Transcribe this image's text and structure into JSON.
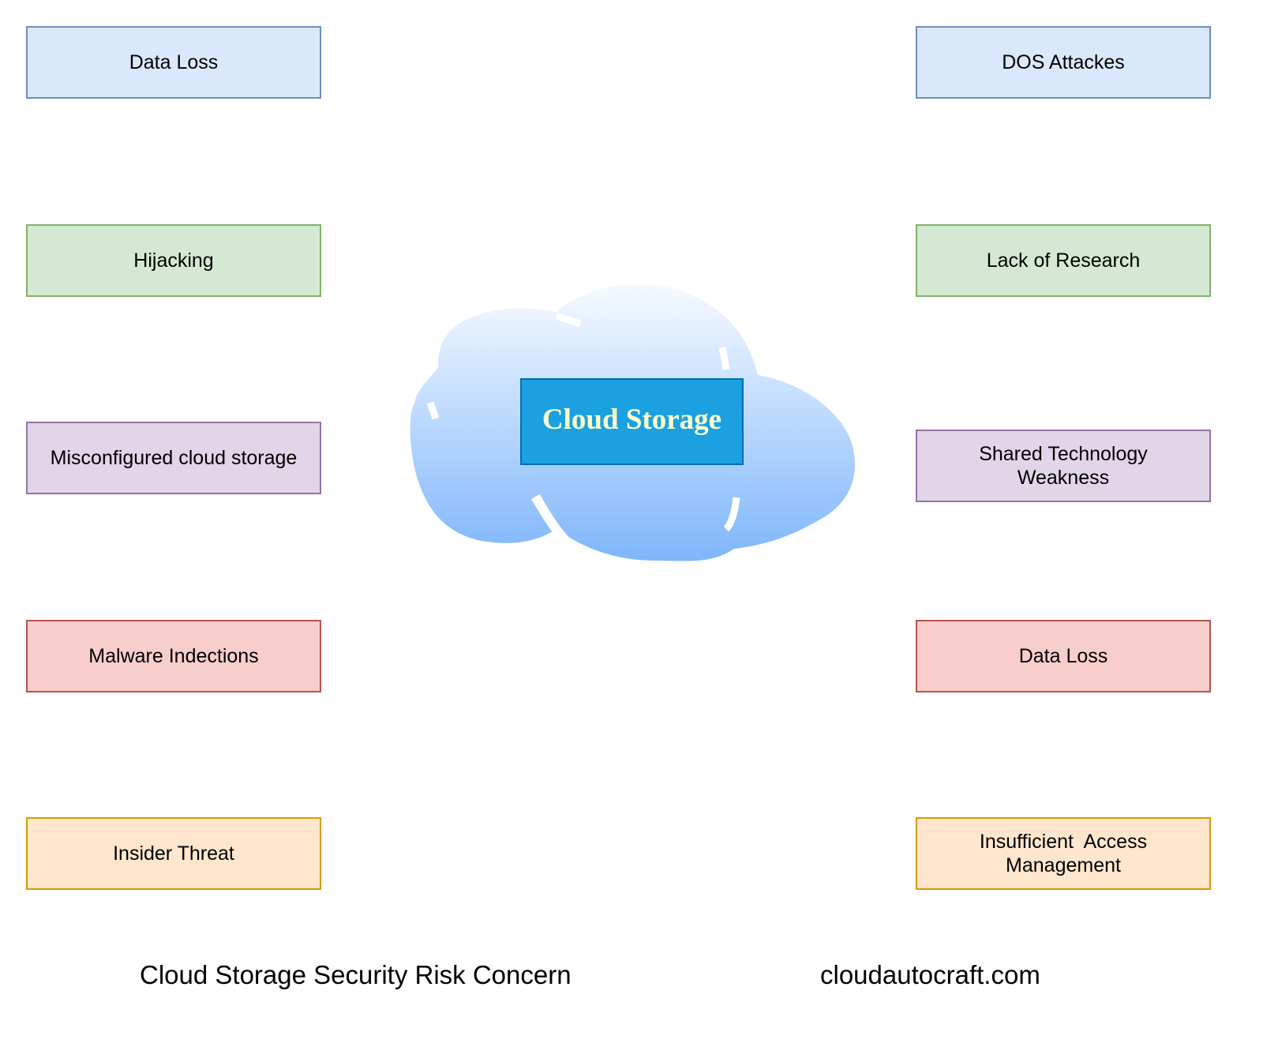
{
  "center": {
    "label": "Cloud Storage",
    "fill": "#1ba1e2",
    "text_color": "#ffffcc"
  },
  "left_boxes": [
    {
      "label": "Data Loss"
    },
    {
      "label": "Hijacking"
    },
    {
      "label": "Misconfigured cloud storage"
    },
    {
      "label": "Malware Indections"
    },
    {
      "label": "Insider Threat"
    }
  ],
  "right_boxes": [
    {
      "label": "DOS Attackes"
    },
    {
      "label": "Lack of Research"
    },
    {
      "label": "Shared Technology Weakness"
    },
    {
      "label": "Data Loss"
    },
    {
      "label": "Insufficient  Access Management"
    }
  ],
  "footer": {
    "caption": "Cloud Storage Security Risk Concern",
    "site": "cloudautocraft.com"
  },
  "colors": {
    "blue": "#dae8fc",
    "green": "#d5e8d4",
    "purple": "#e1d5e7",
    "red": "#f8cecc",
    "orange": "#ffe6cc"
  }
}
